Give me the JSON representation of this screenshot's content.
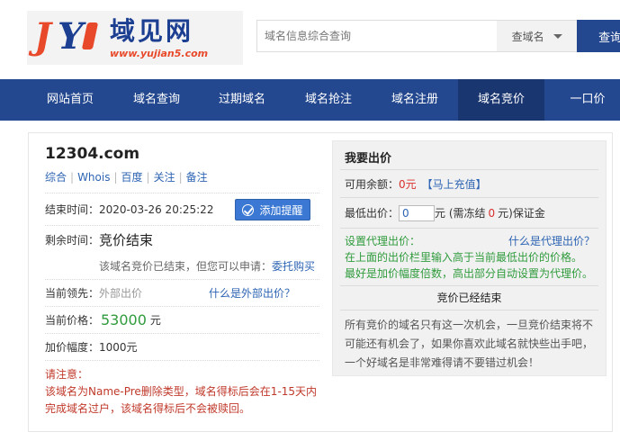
{
  "logo": {
    "name": "域见网",
    "url": "www.yujian5.com"
  },
  "search": {
    "placeholder": "域名信息综合查询",
    "type": "查域名",
    "button": "查询"
  },
  "nav": [
    "网站首页",
    "域名查询",
    "过期域名",
    "域名抢注",
    "域名注册",
    "域名竞价",
    "一口价"
  ],
  "domain": {
    "name": "12304.com",
    "links": [
      "综合",
      "Whois",
      "百度",
      "关注",
      "备注"
    ],
    "end_label": "结束时间：",
    "end_time": "2020-03-26 20:25:22",
    "remind_button": "添加提醒",
    "remain_label": "剩余时间：",
    "remain_value": "竞价结束",
    "ended_text": "该域名竞价已结束，但您可以申请：",
    "delegate_link": "委托购买",
    "leader_label": "当前领先：",
    "leader_value": "外部出价",
    "leader_help": "什么是外部出价？",
    "price_label": "当前价格：",
    "price_value": "53000",
    "price_unit": "元",
    "increment_label": "加价幅度：",
    "increment_value": "1000元",
    "notice_title": "请注意：",
    "notice_text": "该域名为Name-Pre删除类型，域名得标后会在1-15天内完成域名过户，该域名得标后不会被赎回。"
  },
  "bid": {
    "title": "我要出价",
    "balance_label": "可用余额：",
    "balance_value": "0元",
    "recharge_link": "【马上充值】",
    "min_label": "最低出价：",
    "min_value": "0",
    "min_suffix_1": "元 (需冻结",
    "freeze_value": "0",
    "min_suffix_2": "元)保证金",
    "agent_label": "设置代理出价：",
    "agent_help": "什么是代理出价？",
    "agent_line1": "在上面的出价栏里输入高于当前最低出价的价格。",
    "agent_line2": "最好是加价幅度倍数，高出部分自动设置为代理价。",
    "ended_title": "竞价已经结束",
    "ended_text": "所有竞价的域名只有这一次机会，一旦竞价结束将不可能还有机会了，如果你喜欢此域名就快些出手吧，一个好域名是非常难得请不要错过机会！"
  }
}
